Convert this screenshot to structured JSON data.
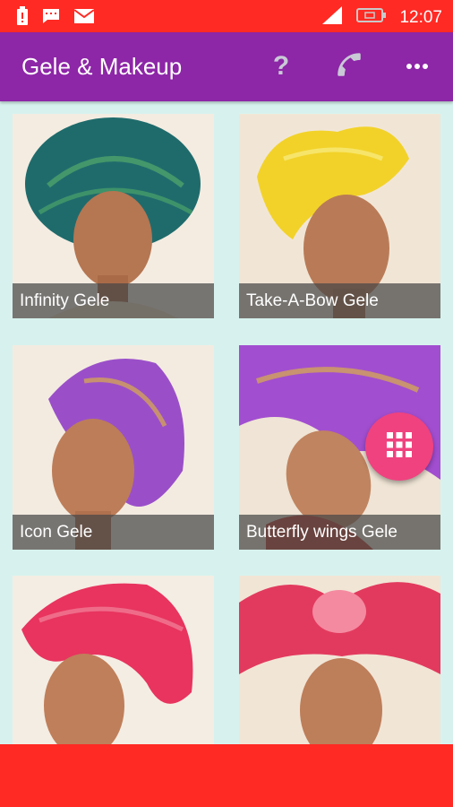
{
  "status": {
    "time": "12:07"
  },
  "app_bar": {
    "title": "Gele & Makeup",
    "actions": [
      {
        "icon": "help-icon",
        "label": "?"
      },
      {
        "icon": "phone-icon"
      },
      {
        "icon": "overflow-menu-icon"
      }
    ]
  },
  "colors": {
    "status_bar": "#ff2a24",
    "app_bar": "#8d26a7",
    "background": "#d7f2ee",
    "fab": "#f0427f"
  },
  "grid": {
    "items": [
      {
        "caption": "Infinity Gele",
        "wrap_color": "#1f6b6c",
        "accent": "#4ca36a"
      },
      {
        "caption": "Take-A-Bow Gele",
        "wrap_color": "#f2d229",
        "accent": "#f7e56a"
      },
      {
        "caption": "Icon Gele",
        "wrap_color": "#9a4fc9",
        "accent": "#d2a15a"
      },
      {
        "caption": "Butterfly wings Gele",
        "wrap_color": "#a24ed0",
        "accent": "#d3a457"
      },
      {
        "caption": "",
        "wrap_color": "#e8345f",
        "accent": "#f07a93"
      },
      {
        "caption": "",
        "wrap_color": "#e23a5e",
        "accent": "#f48aa0"
      }
    ]
  },
  "fab": {
    "icon": "grid-apps-icon"
  }
}
